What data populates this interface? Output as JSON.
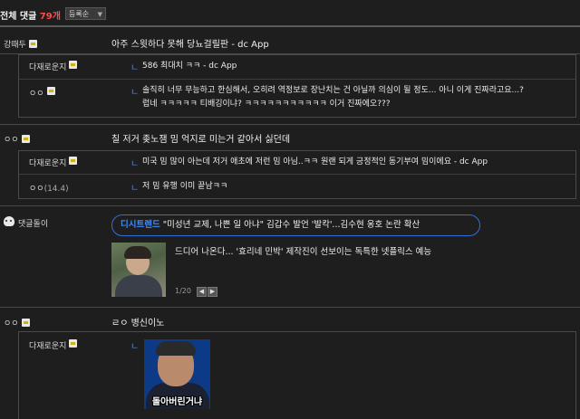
{
  "header": {
    "title": "전체 댓글",
    "count": "79",
    "count_suffix": "개",
    "sort_label": "등록순"
  },
  "comments": [
    {
      "nick": "강때두",
      "text": "아주 스윗하다 못해 당뇨걸릴판 - dc App",
      "replies": [
        {
          "nick": "다재로운지",
          "text": "586 최대치 ㅋㅋ - dc App"
        },
        {
          "nick": "ㅇㅇ",
          "line1": "솔직히 너무 무능하고 한심해서, 오히려 역정보로 장난치는 건 아닐까 의심이 될 정도... 아니 이게 진짜라고요...?",
          "line2": "럽네 ㅋㅋㅋㅋㅋ 티배깅이냐? ㅋㅋㅋㅋㅋㅋㅋㅋㅋㅋㅋ 이거 진짜에오???"
        }
      ]
    },
    {
      "nick": "ㅇㅇ",
      "text": "칠 저거 좆노잼 밈 억지로 미는거 같아서 싫던데",
      "replies": [
        {
          "nick": "다재로운지",
          "text": "미국 밈 많이 아는데 저거 애초에 저런 밈 아님..ㅋㅋ 원랜 되게 긍정적인 동기부여 밈이에요 - dc App"
        },
        {
          "nick": "ㅇㅇ",
          "age": "(14.4)",
          "text": "저 밈 유행 이미 끝남ㅋㅋ"
        }
      ]
    }
  ],
  "bot": {
    "nick": "댓글돌이",
    "site": "디시트렌드",
    "headline": "\"미성년 교제, 나쁜 일 아냐\" 김갑수 발언 '발칵'...김수현 옹호 논란 확산",
    "ad_text": "드디어 나온다... '효리네 민박' 제작진이 선보이는 독특한 넷플릭스 예능",
    "pager": "1/20",
    "prev": "◀",
    "next": "▶"
  },
  "last": {
    "nick": "ㅇㅇ",
    "text": "ㄹㅇ 병신이노",
    "reply_nick": "다재로운지",
    "image_caption": "돌아버린거냐"
  },
  "reply_mark": "ㄴ"
}
